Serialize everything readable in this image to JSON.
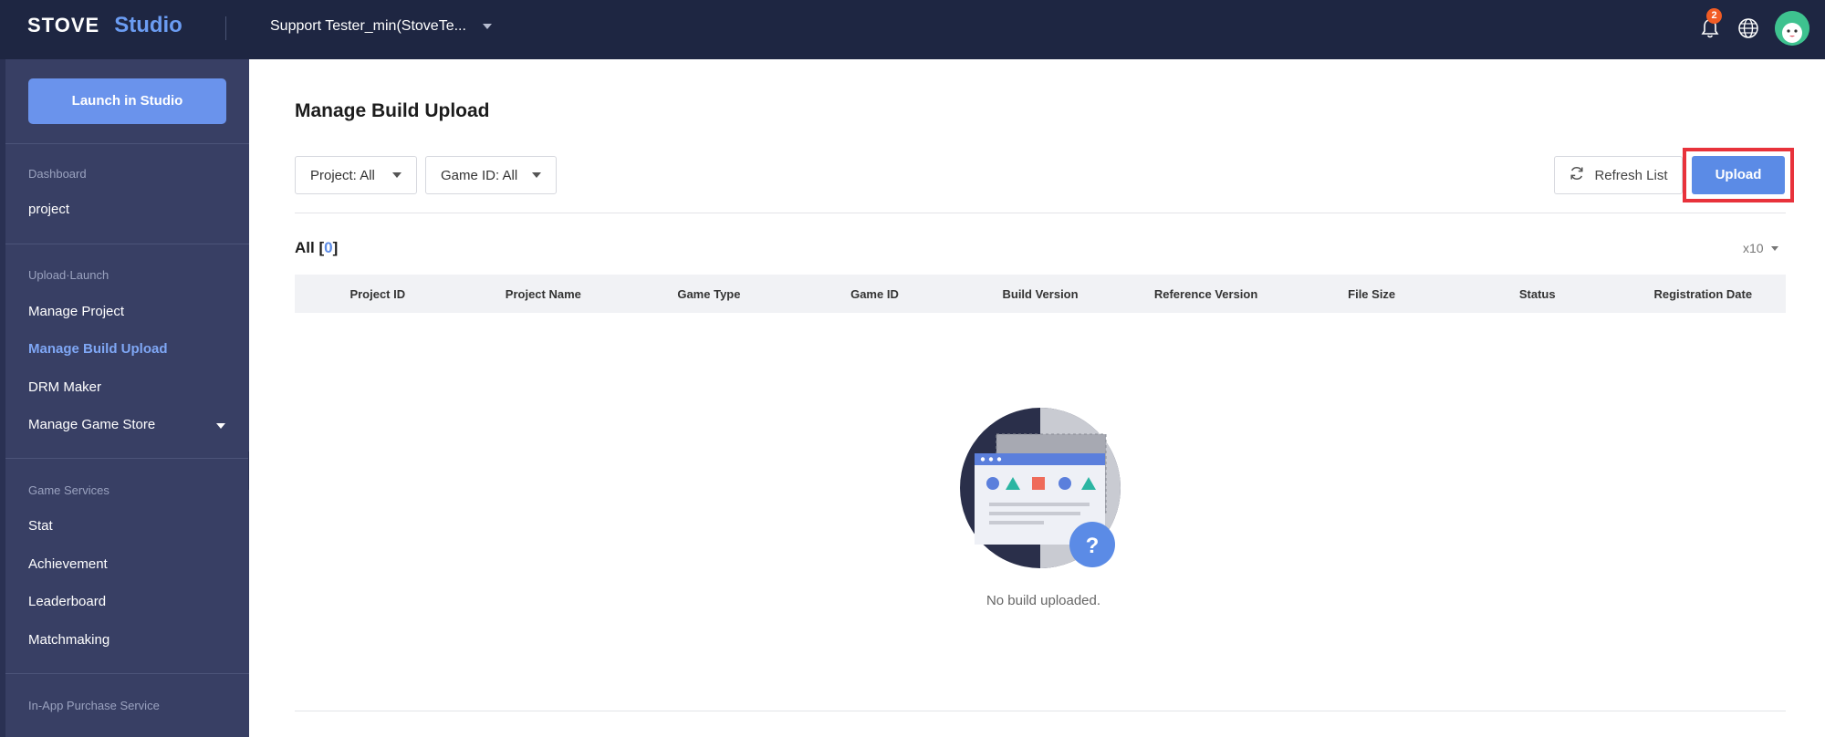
{
  "brand": {
    "stove": "STOVE",
    "studio": "Studio"
  },
  "org": {
    "name": "Support Tester_min(StoveTe..."
  },
  "notifications": {
    "count": "2"
  },
  "sidebar": {
    "launch_label": "Launch in Studio",
    "sections": [
      {
        "title": "Dashboard",
        "items": [
          "project"
        ]
      },
      {
        "title": "Upload·Launch",
        "items": [
          "Manage Project",
          "Manage Build Upload",
          "DRM Maker",
          "Manage Game Store"
        ]
      },
      {
        "title": "Game Services",
        "items": [
          "Stat",
          "Achievement",
          "Leaderboard",
          "Matchmaking"
        ]
      },
      {
        "title": "In-App Purchase Service",
        "items": []
      }
    ],
    "active_item": "Manage Build Upload"
  },
  "main": {
    "title": "Manage Build Upload",
    "filters": {
      "project": "Project: All",
      "game_id": "Game ID: All"
    },
    "refresh_label": "Refresh List",
    "upload_label": "Upload",
    "count_label": "All",
    "count_value": "0",
    "per_page": "x10",
    "columns": [
      "Project ID",
      "Project Name",
      "Game Type",
      "Game ID",
      "Build Version",
      "Reference Version",
      "File Size",
      "Status",
      "Registration Date"
    ],
    "rows": [],
    "empty_text": "No build uploaded."
  },
  "colors": {
    "topbar": "#1e2642",
    "sidebar": "#383f64",
    "accent": "#5b8be6",
    "highlight": "#e8323b"
  },
  "icons": [
    "bell-icon",
    "globe-icon",
    "refresh-icon",
    "chevron-down-icon",
    "collapse-left-icon"
  ]
}
